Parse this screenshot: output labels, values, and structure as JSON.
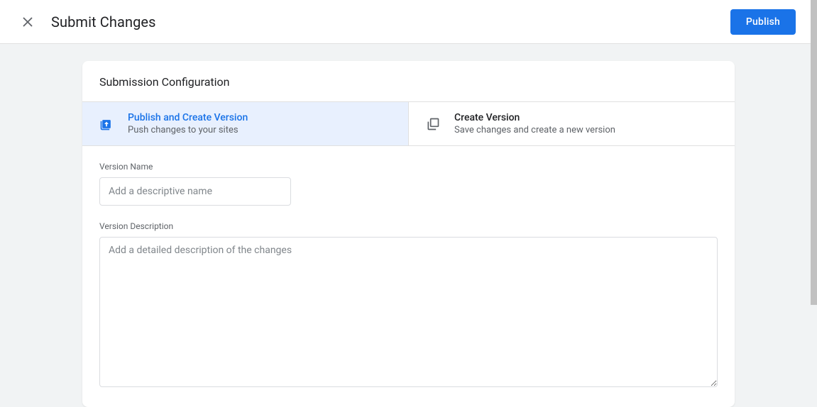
{
  "header": {
    "title": "Submit Changes",
    "publish_label": "Publish"
  },
  "card": {
    "title": "Submission Configuration"
  },
  "tabs": [
    {
      "title": "Publish and Create Version",
      "subtitle": "Push changes to your sites"
    },
    {
      "title": "Create Version",
      "subtitle": "Save changes and create a new version"
    }
  ],
  "form": {
    "name_label": "Version Name",
    "name_placeholder": "Add a descriptive name",
    "desc_label": "Version Description",
    "desc_placeholder": "Add a detailed description of the changes"
  }
}
